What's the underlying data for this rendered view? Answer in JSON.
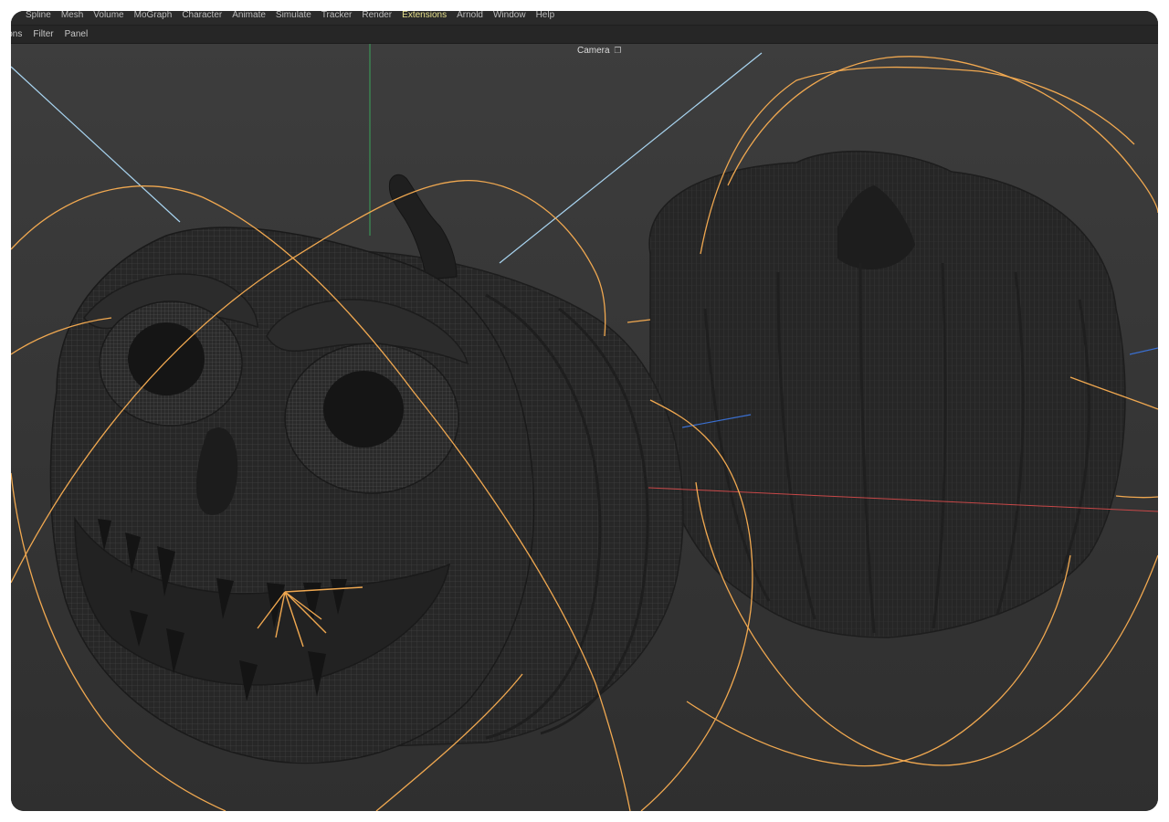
{
  "menubar": {
    "items": [
      {
        "label": "Spline"
      },
      {
        "label": "Mesh"
      },
      {
        "label": "Volume"
      },
      {
        "label": "MoGraph"
      },
      {
        "label": "Character"
      },
      {
        "label": "Animate"
      },
      {
        "label": "Simulate"
      },
      {
        "label": "Tracker"
      },
      {
        "label": "Render"
      },
      {
        "label": "Extensions"
      },
      {
        "label": "Arnold"
      },
      {
        "label": "Window"
      },
      {
        "label": "Help"
      }
    ],
    "active_item": "Extensions",
    "active_color": "#e6e08c"
  },
  "viewport_menu": {
    "items": [
      {
        "label": "ions"
      },
      {
        "label": "Filter"
      },
      {
        "label": "Panel"
      }
    ]
  },
  "viewport": {
    "camera_label": "Camera",
    "camera_icon": "camera-icon",
    "objects": [
      "pumpkin-left-jackolantern",
      "pumpkin-right"
    ],
    "colors": {
      "background": "#3a3a3a",
      "wire": "#5a5a5a",
      "mesh": "#262626",
      "spline": "#f0a850",
      "axis_x": "#c84848",
      "axis_y": "#3aa35a",
      "axis_z": "#3a6fd0",
      "guide": "#a8d4f0"
    }
  }
}
